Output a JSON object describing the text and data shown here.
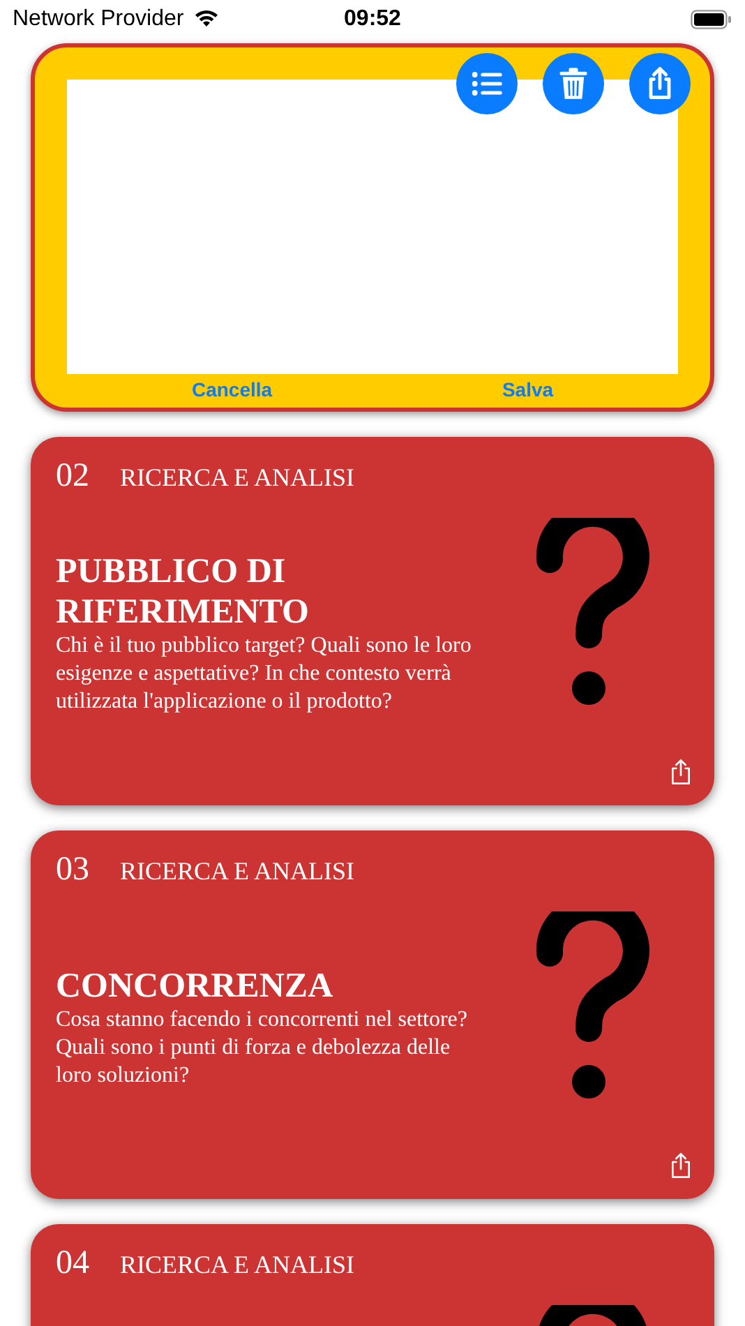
{
  "status_bar": {
    "carrier": "Network Provider",
    "time": "09:52"
  },
  "drawing_pad": {
    "actions": [
      "Cancella",
      "Salva"
    ]
  },
  "cards": [
    {
      "number": "02",
      "category": "RICERCA E ANALISI",
      "title": "PUBBLICO DI RIFERIMENTO",
      "body": "Chi è il tuo pubblico target? Quali sono le loro esigenze e aspettative? In che contesto verrà utilizzata l'applicazione o il prodotto?"
    },
    {
      "number": "03",
      "category": "RICERCA E ANALISI",
      "title": "CONCORRENZA",
      "body": "Cosa stanno facendo i concorrenti nel settore? Quali sono i punti di forza e debolezza delle loro soluzioni?"
    },
    {
      "number": "04",
      "category": "RICERCA E ANALISI"
    }
  ]
}
